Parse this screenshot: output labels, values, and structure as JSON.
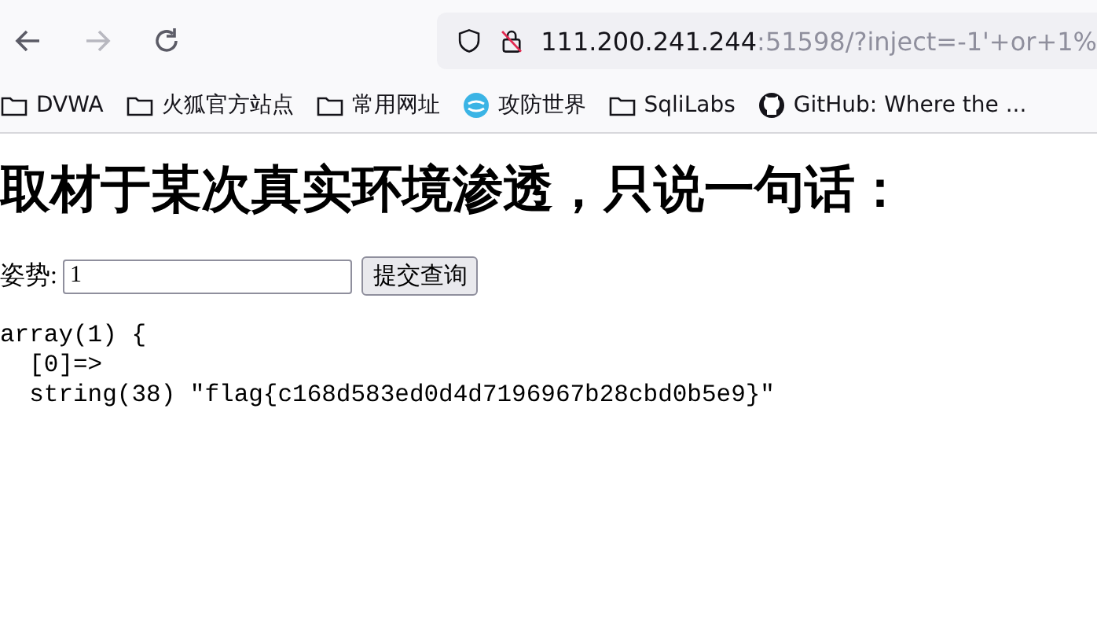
{
  "browser": {
    "nav_buttons": [
      {
        "kind": "back",
        "disabled": false
      },
      {
        "kind": "forward",
        "disabled": true
      },
      {
        "kind": "reload",
        "disabled": false
      }
    ],
    "address": {
      "host": "111.200.241.244",
      "rest": ":51598/?inject=-1'+or+1%"
    },
    "bookmarks": [
      {
        "kind": "folder",
        "label": "DVWA"
      },
      {
        "kind": "folder",
        "label": "火狐官方站点"
      },
      {
        "kind": "folder",
        "label": "常用网址"
      },
      {
        "kind": "site",
        "label": "攻防世界"
      },
      {
        "kind": "folder",
        "label": "SqliLabs"
      },
      {
        "kind": "github",
        "label": "GitHub: Where the ..."
      }
    ]
  },
  "page": {
    "heading": "取材于某次真实环境渗透，只说一句话：",
    "form": {
      "label": "姿势:",
      "value": "1",
      "button": "提交查询"
    },
    "output": [
      "array(1) {",
      "  [0]=>",
      "  string(38) \"flag{c168d583ed0d4d7196967b28cbd0b5e9}\""
    ]
  }
}
